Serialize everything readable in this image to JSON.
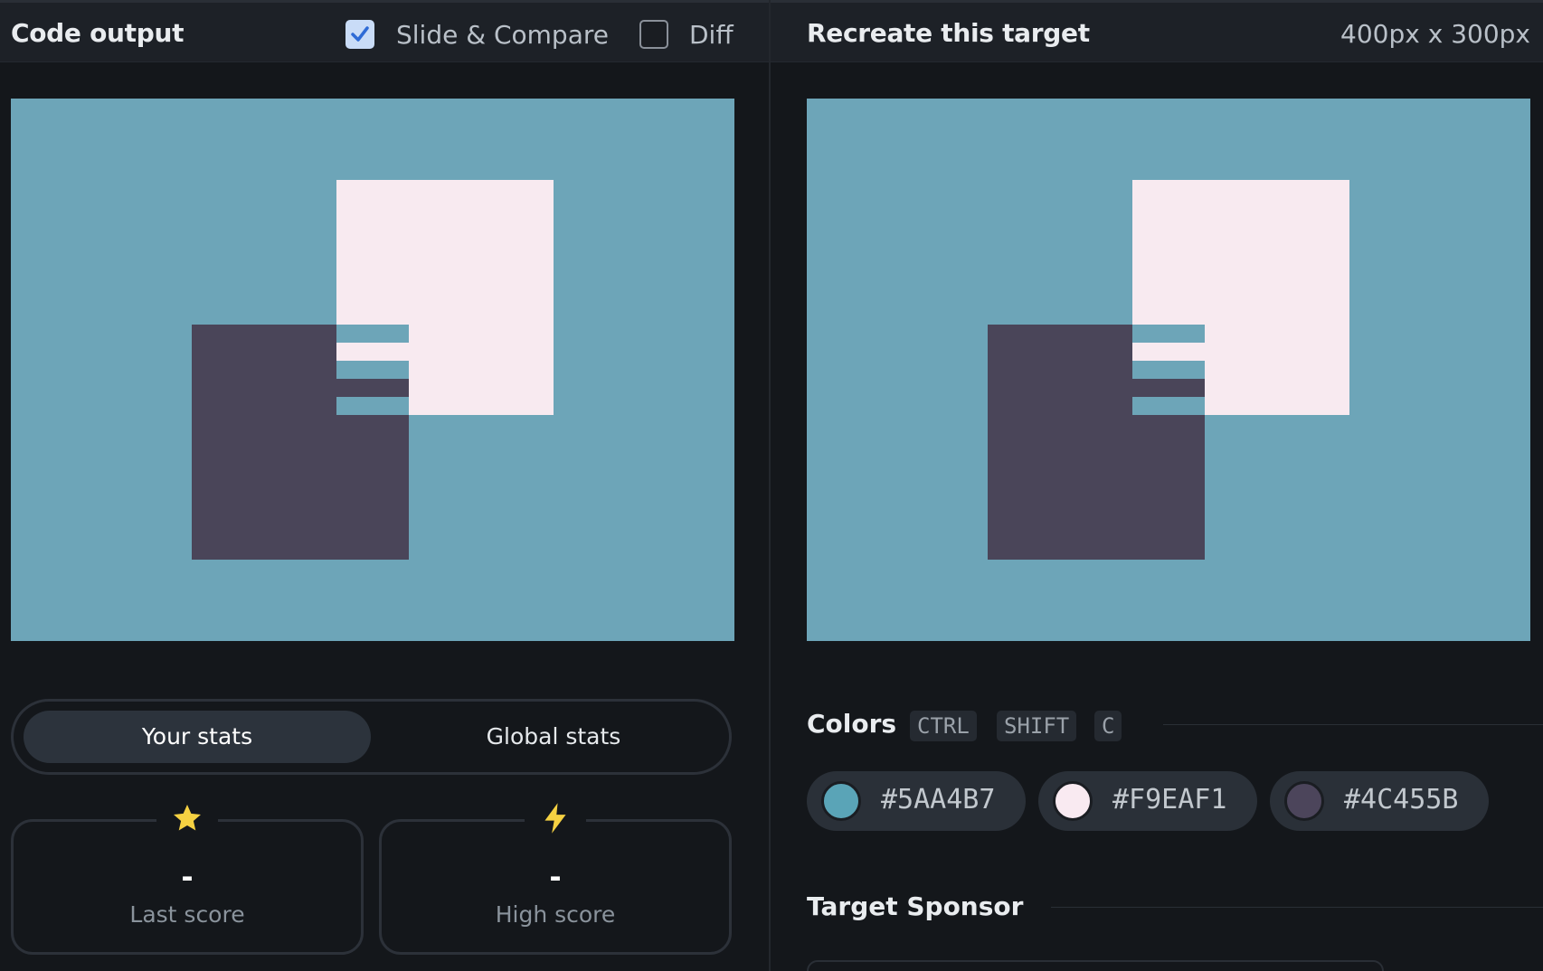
{
  "left_header": {
    "title": "Code output",
    "slide_compare_label": "Slide & Compare",
    "slide_compare_checked": true,
    "diff_label": "Diff",
    "diff_checked": false
  },
  "right_header": {
    "title": "Recreate this target",
    "size_label": "400px x 300px"
  },
  "stats": {
    "your_stats_label": "Your stats",
    "global_stats_label": "Global stats",
    "last_score_value": "-",
    "last_score_label": "Last score",
    "high_score_value": "-",
    "high_score_label": "High score",
    "last_score_icon": "star-icon",
    "high_score_icon": "lightning-icon"
  },
  "colors": {
    "heading": "Colors",
    "shortcut_keys": [
      "CTRL",
      "SHIFT",
      "C"
    ],
    "swatches": [
      {
        "hex": "#5AA4B7"
      },
      {
        "hex": "#F9EAF1"
      },
      {
        "hex": "#4C455B"
      }
    ]
  },
  "sponsor": {
    "heading": "Target Sponsor"
  },
  "theme": {
    "background": "#14171b",
    "canvas_bg": "#6da5b8",
    "pink": "#f8eaf0",
    "dark": "#4a4559",
    "accent_check": "#c9dcf7",
    "star_color": "#f5d142"
  }
}
